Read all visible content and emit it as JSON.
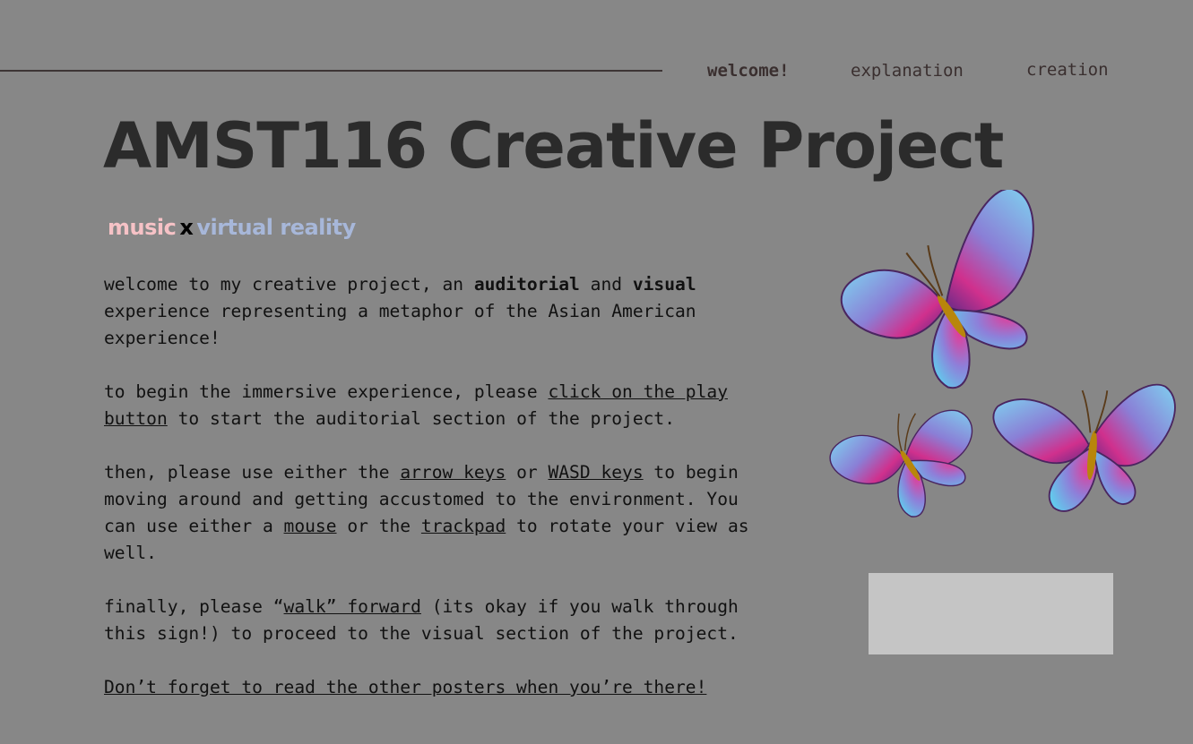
{
  "nav": {
    "items": [
      {
        "label": "welcome!",
        "active": true
      },
      {
        "label": "explanation",
        "active": false
      },
      {
        "label": "creation",
        "active": false
      }
    ]
  },
  "header": {
    "title": "AMST116 Creative Project",
    "subtitle": {
      "music": "music",
      "x": "x",
      "vr": "virtual reality"
    }
  },
  "intro": {
    "p1": {
      "a": "welcome to my creative project, an ",
      "b": "auditorial",
      "c": " and ",
      "d": "visual",
      "e": " experience representing a metaphor of the Asian American experience!"
    },
    "p2": {
      "a": "to begin the immersive experience, please ",
      "link": "click on the play button",
      "b": " to start the auditorial section of the project."
    },
    "p3": {
      "a": "then, please use either the ",
      "arrow": "arrow keys",
      "b": " or ",
      "wasd": "WASD keys",
      "c": " to begin moving around and getting accustomed to the environment. You can use either a ",
      "mouse": "mouse",
      "d": " or the ",
      "trackpad": "trackpad",
      "e": " to rotate your view as well."
    },
    "p4": {
      "a": "finally, please “",
      "walk": "walk” forward",
      "b": " (its okay if you walk through this sign!) to proceed to the visual section of the project."
    },
    "p5": {
      "link": "Don’t forget to read the other posters when you’re there!"
    }
  },
  "colors": {
    "background": "#878787",
    "music": "#f6c2c6",
    "virtual_reality": "#a7b7d9",
    "title": "#2b2b2b",
    "placeholder_box": "#c5c5c5"
  },
  "icons": {
    "decor": "butterfly-icon"
  }
}
